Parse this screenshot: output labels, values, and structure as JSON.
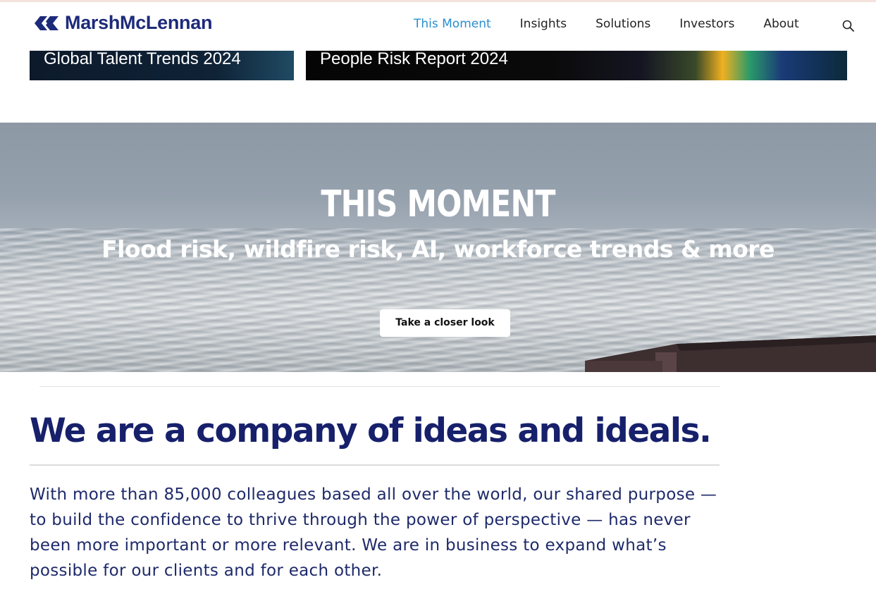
{
  "brand": {
    "name": "MarshMcLennan",
    "color": "#1d2a7a"
  },
  "nav": {
    "items": [
      {
        "label": "This Moment",
        "active": true
      },
      {
        "label": "Insights",
        "active": false
      },
      {
        "label": "Solutions",
        "active": false
      },
      {
        "label": "Investors",
        "active": false
      },
      {
        "label": "About",
        "active": false
      }
    ],
    "search_icon": "search-icon"
  },
  "cards": [
    {
      "title": "Global Talent Trends 2024"
    },
    {
      "title": "People Risk Report 2024"
    }
  ],
  "hero": {
    "title": "THIS MOMENT",
    "subtitle": "Flood risk, wildfire risk, AI, workforce trends & more",
    "button_label": "Take a closer look"
  },
  "intro": {
    "headline": "We are a company of ideas and ideals.",
    "body": "With more than 85,000 colleagues based all over the world, our shared purpose — to build the confidence to thrive through the power of perspective — has never been more important or more relevant. We are in business to expand what’s possible for our clients and for each other."
  },
  "colors": {
    "accent": "#2b8fd0",
    "heading": "#17206b",
    "body": "#1e2a6a"
  }
}
